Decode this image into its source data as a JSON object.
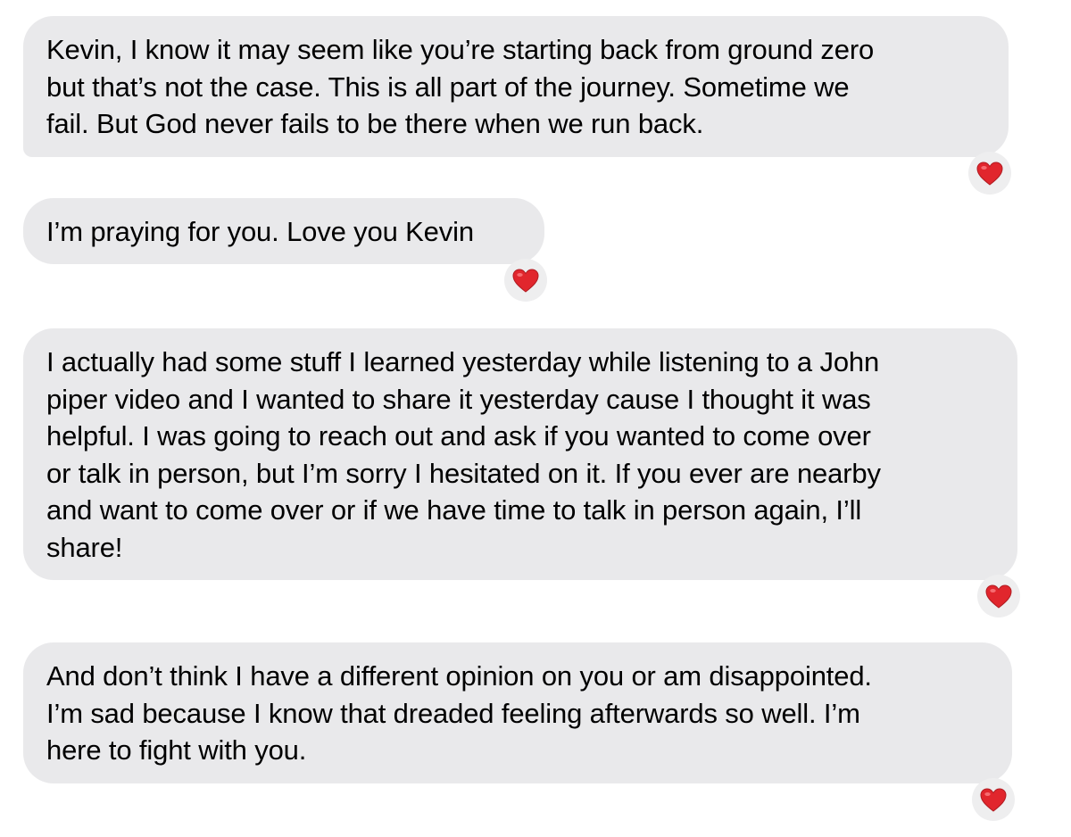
{
  "conversation": {
    "messages": [
      {
        "text": "Kevin, I know it may seem like you’re starting back from ground zero\nbut that’s not the case. This is all part of the journey. Sometime we\nfail. But God never fails to be there when we run back.",
        "reaction": "heart-icon"
      },
      {
        "text": "I’m praying for you. Love you Kevin",
        "reaction": "heart-icon"
      },
      {
        "text": "I actually had some stuff I learned yesterday while listening to a John\npiper video and I wanted to share it yesterday cause I thought it was\nhelpful. I was going to reach out and ask if you wanted to come over\nor talk in person, but I’m sorry I hesitated on it. If you ever are nearby\nand want to come over or if we have time to talk in person again, I’ll\nshare!",
        "reaction": "heart-icon"
      },
      {
        "text": "And don’t think I have a different opinion on you or am disappointed.\nI’m sad because I know that dreaded feeling afterwards so well. I’m\nhere to fight with you.",
        "reaction": "heart-icon"
      }
    ]
  },
  "colors": {
    "bubble_background": "#e9e9eb",
    "heart": "#e1262d",
    "text": "#000000"
  }
}
